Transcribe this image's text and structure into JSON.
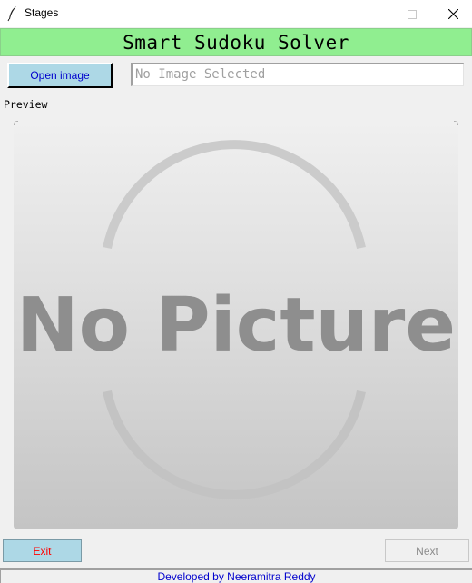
{
  "window": {
    "title": "Stages",
    "app_icon": "feather-icon",
    "controls": [
      "minimize-icon",
      "maximize-icon",
      "close-icon"
    ]
  },
  "banner": {
    "title": "Smart Sudoku Solver",
    "background": "#90ee90"
  },
  "file_picker": {
    "open_label": "Open image",
    "path_value": "No Image Selected",
    "button_color": "#add8e6"
  },
  "preview": {
    "label": "Preview",
    "placeholder_text": "No Picture"
  },
  "footer": {
    "exit_label": "Exit",
    "next_label": "Next",
    "credit": "Developed by Neeramitra Reddy"
  }
}
